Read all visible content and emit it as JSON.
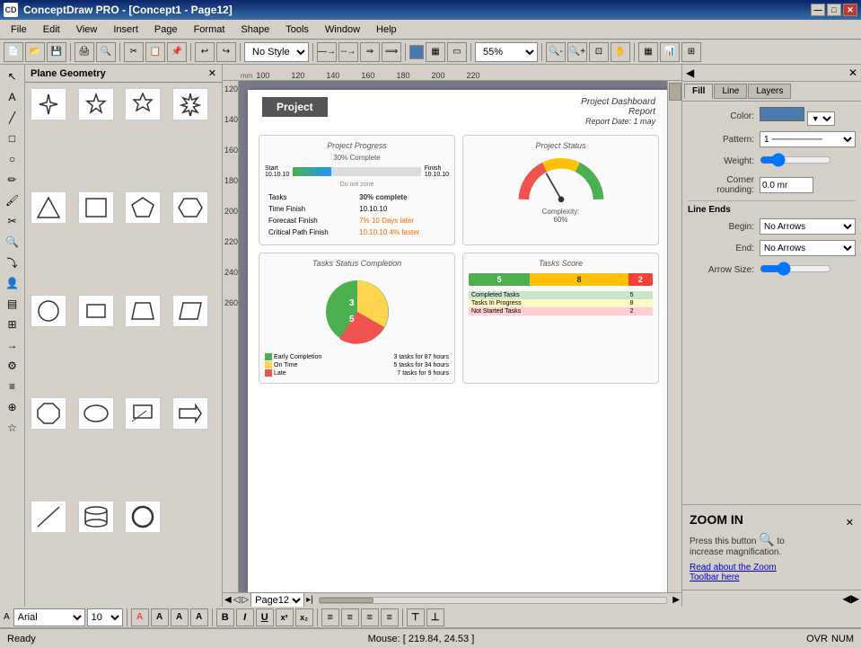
{
  "titlebar": {
    "title": "ConceptDraw PRO - [Concept1 - Page12]",
    "icon_label": "CD",
    "min_label": "—",
    "max_label": "□",
    "close_label": "✕",
    "app_min": "—",
    "app_max": "□",
    "app_close": "✕"
  },
  "menubar": {
    "items": [
      "File",
      "Edit",
      "View",
      "Insert",
      "Page",
      "Format",
      "Shape",
      "Tools",
      "Window",
      "Help"
    ]
  },
  "toolbar": {
    "style_dropdown": "No Style",
    "zoom_dropdown": "55%"
  },
  "shape_panel": {
    "title": "Plane Geometry",
    "close_label": "✕"
  },
  "right_tabs": {
    "fill_label": "Fill",
    "line_label": "Line",
    "layers_label": "Layers"
  },
  "fill_panel": {
    "color_label": "Color:",
    "pattern_label": "Pattern:",
    "pattern_value": "1",
    "weight_label": "Weight:",
    "corner_label": "Corner rounding:",
    "corner_value": "0.0 mr"
  },
  "line_ends": {
    "title": "Line Ends",
    "begin_label": "Begin:",
    "end_label": "End:",
    "begin_value": "No Arrows",
    "end_value": "No Arrows",
    "arrow_size_label": "Arrow Size:"
  },
  "zoom_help": {
    "title": "ZOOM IN",
    "description": "Press this button",
    "description2": "to increase magnification.",
    "link_text": "Read about the Zoom\nToolbar here"
  },
  "canvas": {
    "page_name": "Page12",
    "project_badge": "Project",
    "dashboard_title": "Project Dashboard\nReport",
    "report_date_label": "Report Date: 1 may",
    "progress_card": {
      "title": "Project Progress",
      "complete_pct": "30% Complete",
      "start_label": "Start",
      "start_date": "10.10.10",
      "finish_label": "Finish",
      "finish_date": "10.10.10",
      "date_zone": "Do not zone",
      "rows": [
        {
          "label": "Tasks",
          "value": "30% complete"
        },
        {
          "label": "Time Finish",
          "value": "10.10.10"
        },
        {
          "label": "Forecast Finish",
          "value": "7% 10 Days later"
        },
        {
          "label": "Critical Path Finish",
          "value": "10.10.10  4% faster"
        }
      ]
    },
    "status_card": {
      "title": "Project Status",
      "complexity_label": "Complexity:",
      "complexity_value": "60%"
    },
    "tasks_completion_card": {
      "title": "Tasks Status Completion",
      "legend": [
        {
          "color": "#4caf50",
          "label": "Early Completion",
          "value": "3 tasks for 87 hours"
        },
        {
          "color": "#ffd54f",
          "label": "On Time",
          "value": "5 tasks for 34 hours"
        },
        {
          "color": "#ef5350",
          "label": "Late",
          "value": "7 tasks for 9 hours"
        }
      ]
    },
    "tasks_score_card": {
      "title": "Tasks Score",
      "score_rows": [
        {
          "color": "#c8e6c9",
          "label": "Completed Tasks",
          "value": "5"
        },
        {
          "color": "#fff9c4",
          "label": "Tasks In Progress",
          "value": "8"
        },
        {
          "color": "#ffcdd2",
          "label": "Not Started Tasks",
          "value": "2"
        }
      ]
    }
  },
  "statusbar": {
    "ready_label": "Ready",
    "mouse_label": "Mouse: [ 219.84, 24.53 ]",
    "ovr_label": "OVR",
    "num_label": "NUM"
  },
  "format_bar": {
    "font_name": "Arial",
    "font_size": "10",
    "bold_label": "B",
    "italic_label": "I",
    "underline_label": "U"
  }
}
